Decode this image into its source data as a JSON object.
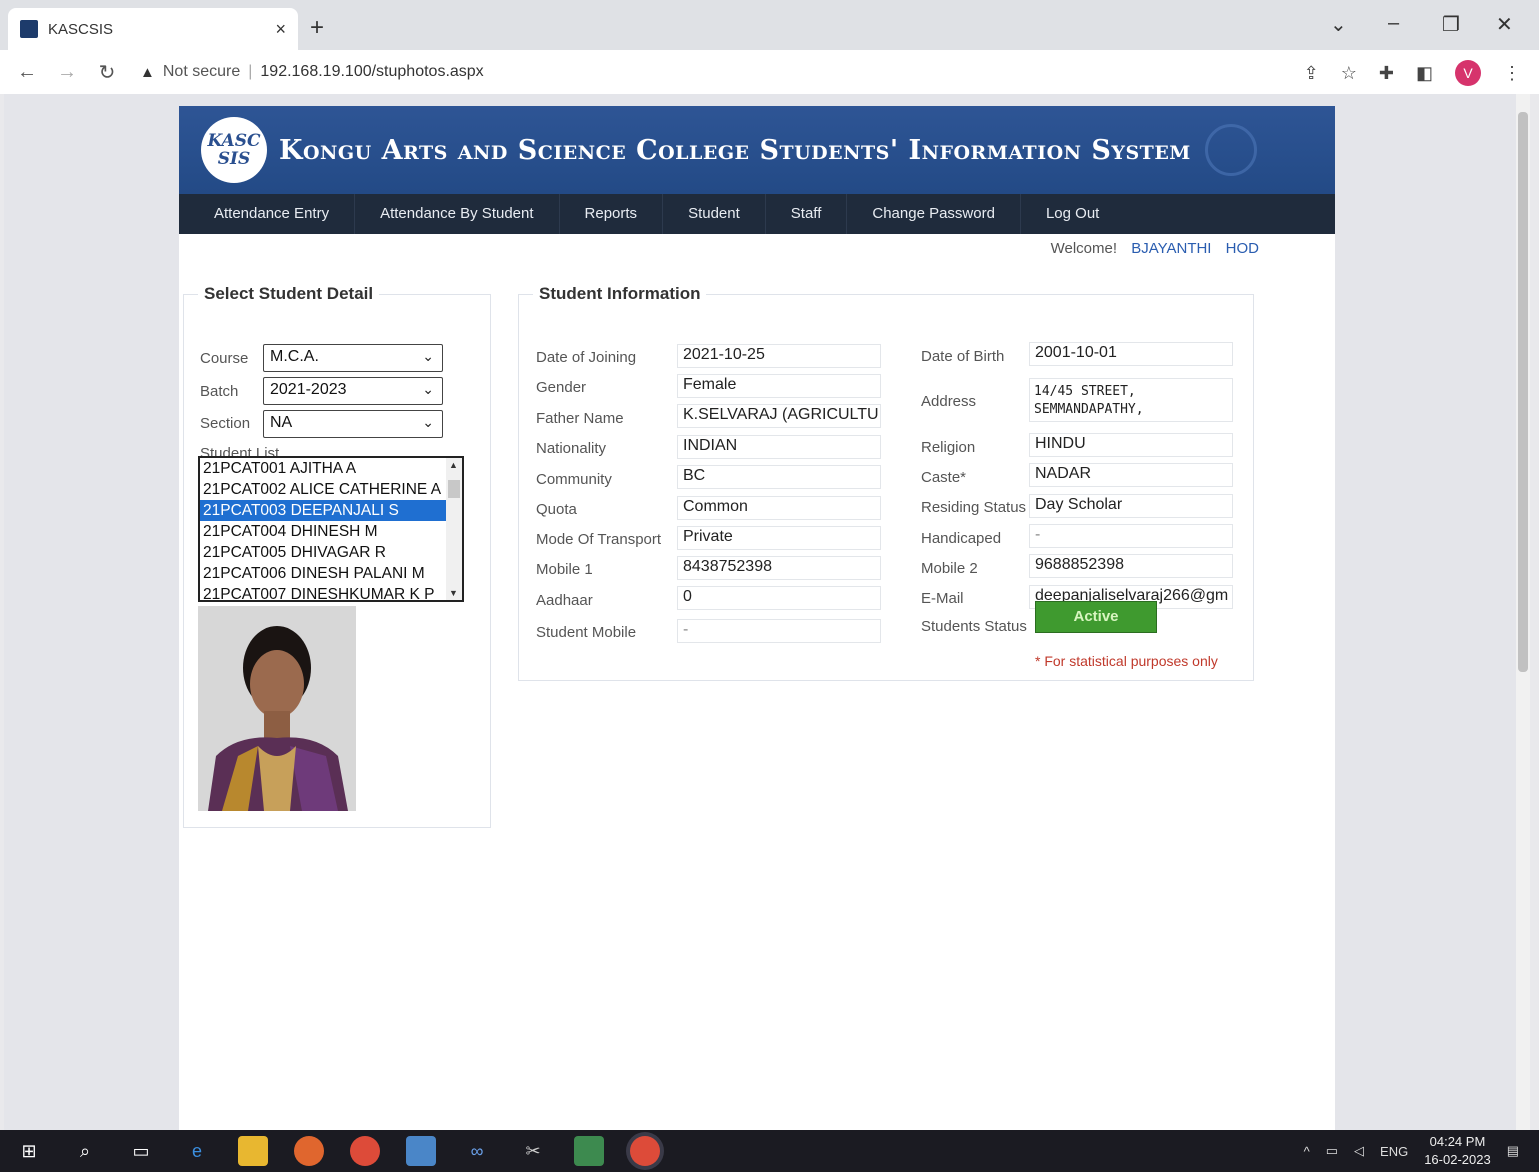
{
  "browser": {
    "tab_title": "KASCSIS",
    "tab_close": "×",
    "new_tab": "+",
    "not_secure": "Not secure",
    "url": "192.168.19.100/stuphotos.aspx",
    "avatar_letter": "V"
  },
  "header": {
    "logo_text": "KASC SIS",
    "title": "Kongu Arts and Science College Students' Information System"
  },
  "menu": [
    "Attendance Entry",
    "Attendance By Student",
    "Reports",
    "Student",
    "Staff",
    "Change Password",
    "Log Out"
  ],
  "welcome": {
    "label": "Welcome!",
    "user": "BJAYANTHI",
    "role": "HOD"
  },
  "select_panel": {
    "legend": "Select Student Detail",
    "course_label": "Course",
    "course_value": "M.C.A.",
    "batch_label": "Batch",
    "batch_value": "2021-2023",
    "section_label": "Section",
    "section_value": "NA",
    "student_list_label": "Student List",
    "students": [
      "21PCAT001 AJITHA A",
      "21PCAT002 ALICE CATHERINE A",
      "21PCAT003 DEEPANJALI S",
      "21PCAT004 DHINESH M",
      "21PCAT005 DHIVAGAR R",
      "21PCAT006 DINESH PALANI M",
      "21PCAT007 DINESHKUMAR K P"
    ],
    "selected_index": 2
  },
  "info_panel": {
    "legend": "Student Information",
    "date_of_joining_label": "Date of Joining",
    "date_of_joining": "2021-10-25",
    "gender_label": "Gender",
    "gender": "Female",
    "father_name_label": "Father Name",
    "father_name": "K.SELVARAJ (AGRICULTU",
    "nationality_label": "Nationality",
    "nationality": "INDIAN",
    "community_label": "Community",
    "community": "BC",
    "quota_label": "Quota",
    "quota": "Common",
    "transport_label": "Mode Of Transport",
    "transport": "Private",
    "mobile1_label": "Mobile 1",
    "mobile1": "8438752398",
    "aadhaar_label": "Aadhaar",
    "aadhaar": "0",
    "student_mobile_label": "Student Mobile",
    "student_mobile": "-",
    "dob_label": "Date of Birth",
    "dob": "2001-10-01",
    "address_label": "Address",
    "address": "14/45 STREET,\nSEMMANDAPATHY,",
    "religion_label": "Religion",
    "religion": "HINDU",
    "caste_label": "Caste*",
    "caste": "NADAR",
    "residing_label": "Residing Status",
    "residing": "Day Scholar",
    "handicaped_label": "Handicaped",
    "handicaped": "-",
    "mobile2_label": "Mobile 2",
    "mobile2": "9688852398",
    "email_label": "E-Mail",
    "email": "deepanjaliselvaraj266@gm",
    "status_label": "Students Status",
    "status": "Active",
    "note": "* For statistical purposes only"
  },
  "taskbar": {
    "lang": "ENG",
    "time": "04:24 PM",
    "date": "16-02-2023"
  }
}
